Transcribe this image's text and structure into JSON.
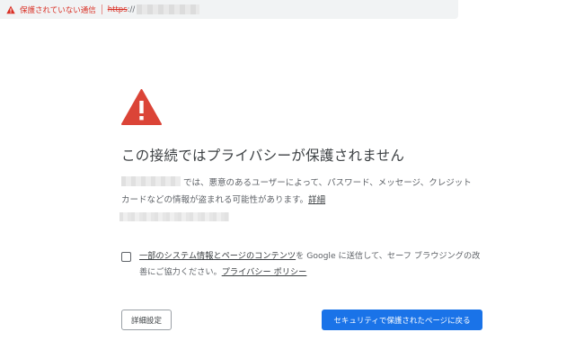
{
  "address_bar": {
    "security_label": "保護されていない通信",
    "scheme": "https",
    "scheme_suffix": "://"
  },
  "interstitial": {
    "heading": "この接続ではプライバシーが保護されません",
    "body_text": "では、悪意のあるユーザーによって、パスワード、メッセージ、クレジット カードなどの情報が盗まれる可能性があります。",
    "details_link": "詳細",
    "optin": {
      "link_text": "一部のシステム情報とページのコンテンツ",
      "text_middle": "を Google に送信して、セーフ ブラウジングの改善にご協力ください。",
      "privacy_link": "プライバシー ポリシー"
    },
    "advanced_button": "詳細設定",
    "back_button": "セキュリティで保護されたページに戻る"
  },
  "colors": {
    "danger": "#d93025",
    "warning_icon": "#db4437",
    "primary_button": "#1a73e8"
  },
  "icons": {
    "small_warning": "warning-triangle-icon",
    "large_warning": "warning-triangle-icon"
  }
}
